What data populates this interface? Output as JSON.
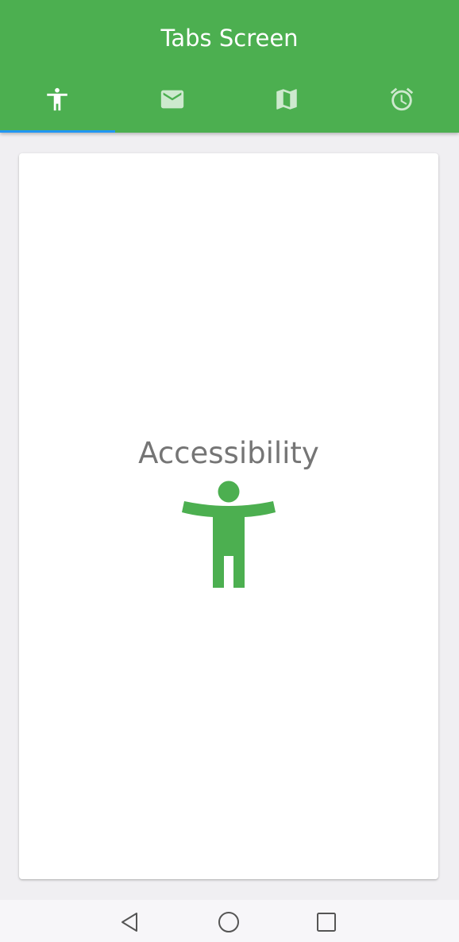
{
  "app_bar": {
    "title": "Tabs Screen"
  },
  "tabs": [
    {
      "icon": "accessibility-icon",
      "selected": true
    },
    {
      "icon": "mail-icon",
      "selected": false
    },
    {
      "icon": "map-icon",
      "selected": false
    },
    {
      "icon": "alarm-icon",
      "selected": false
    }
  ],
  "content": {
    "label": "Accessibility",
    "icon": "accessibility-icon"
  },
  "nav_bar": {
    "buttons": [
      "back-icon",
      "home-icon",
      "recents-icon"
    ]
  },
  "colors": {
    "primary": "#4caf50",
    "indicator": "#2196f3",
    "label_text": "#757575",
    "background": "#f0eff2"
  }
}
